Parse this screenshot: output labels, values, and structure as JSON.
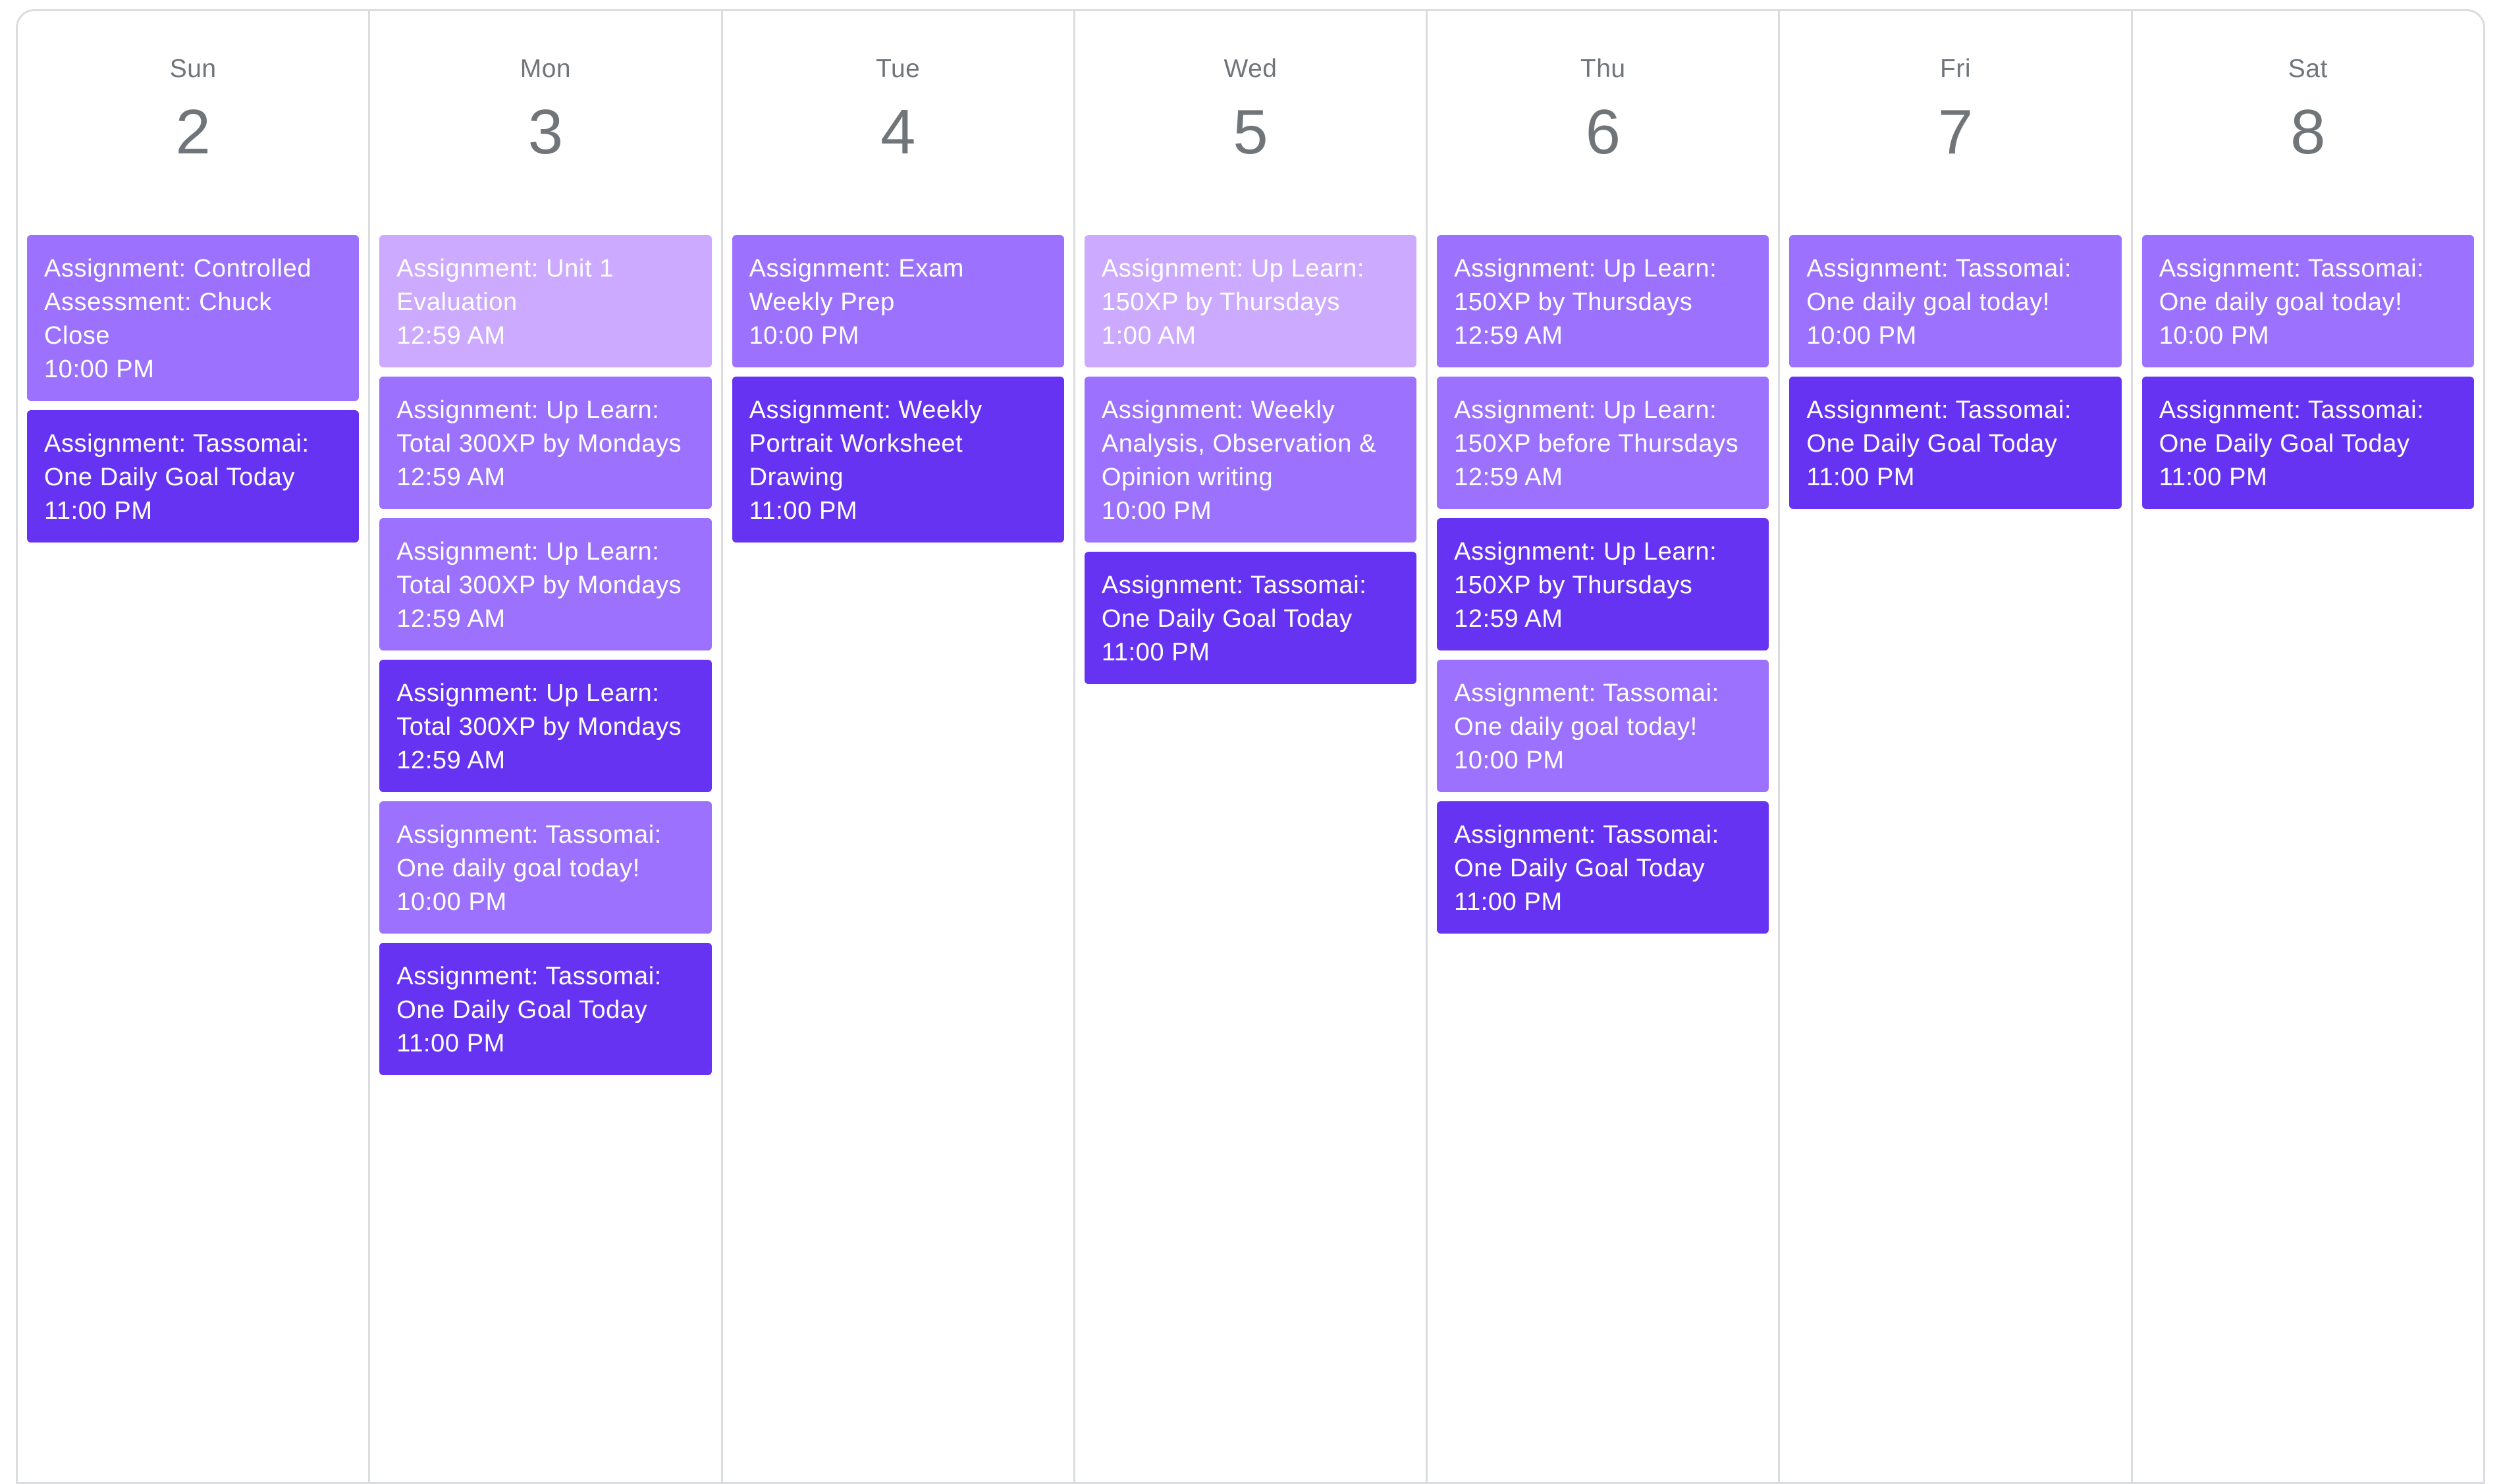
{
  "calendar": {
    "colors": {
      "light": "#ccaaff",
      "mid": "#9b71fe",
      "dark": "#6633f2",
      "header_text": "#70757a",
      "grid_line": "#dadce0"
    },
    "days": [
      {
        "name": "Sun",
        "date": "2",
        "events": [
          {
            "title": "Assignment: Controlled Assessment: Chuck Close",
            "time": "10:00 PM",
            "shade": "mid"
          },
          {
            "title": "Assignment: Tassomai: One Daily Goal Today",
            "time": "11:00 PM",
            "shade": "dark"
          }
        ]
      },
      {
        "name": "Mon",
        "date": "3",
        "events": [
          {
            "title": "Assignment: Unit 1 Evaluation",
            "time": "12:59 AM",
            "shade": "light"
          },
          {
            "title": "Assignment: Up Learn: Total 300XP by Mondays",
            "time": "12:59 AM",
            "shade": "mid"
          },
          {
            "title": "Assignment: Up Learn: Total 300XP by Mondays",
            "time": "12:59 AM",
            "shade": "mid"
          },
          {
            "title": "Assignment: Up Learn: Total 300XP by Mondays",
            "time": "12:59 AM",
            "shade": "dark"
          },
          {
            "title": "Assignment: Tassomai: One daily goal today!",
            "time": "10:00 PM",
            "shade": "mid"
          },
          {
            "title": "Assignment: Tassomai: One Daily Goal Today",
            "time": "11:00 PM",
            "shade": "dark"
          }
        ]
      },
      {
        "name": "Tue",
        "date": "4",
        "events": [
          {
            "title": "Assignment: Exam Weekly Prep",
            "time": "10:00 PM",
            "shade": "mid"
          },
          {
            "title": "Assignment: Weekly Portrait Worksheet Drawing",
            "time": "11:00 PM",
            "shade": "dark"
          }
        ]
      },
      {
        "name": "Wed",
        "date": "5",
        "events": [
          {
            "title": "Assignment: Up Learn: 150XP by Thursdays",
            "time": "1:00 AM",
            "shade": "light"
          },
          {
            "title": "Assignment: Weekly Analysis, Observation & Opinion writing",
            "time": "10:00 PM",
            "shade": "mid"
          },
          {
            "title": "Assignment: Tassomai: One Daily Goal Today",
            "time": "11:00 PM",
            "shade": "dark"
          }
        ]
      },
      {
        "name": "Thu",
        "date": "6",
        "events": [
          {
            "title": "Assignment: Up Learn: 150XP by Thursdays",
            "time": "12:59 AM",
            "shade": "mid"
          },
          {
            "title": "Assignment: Up Learn: 150XP before Thursdays",
            "time": "12:59 AM",
            "shade": "mid"
          },
          {
            "title": "Assignment: Up Learn: 150XP by Thursdays",
            "time": "12:59 AM",
            "shade": "dark"
          },
          {
            "title": "Assignment: Tassomai: One daily goal today!",
            "time": "10:00 PM",
            "shade": "mid"
          },
          {
            "title": "Assignment: Tassomai: One Daily Goal Today",
            "time": "11:00 PM",
            "shade": "dark"
          }
        ]
      },
      {
        "name": "Fri",
        "date": "7",
        "events": [
          {
            "title": "Assignment: Tassomai: One daily goal today!",
            "time": "10:00 PM",
            "shade": "mid"
          },
          {
            "title": "Assignment: Tassomai: One Daily Goal Today",
            "time": "11:00 PM",
            "shade": "dark"
          }
        ]
      },
      {
        "name": "Sat",
        "date": "8",
        "events": [
          {
            "title": "Assignment: Tassomai: One daily goal today!",
            "time": "10:00 PM",
            "shade": "mid"
          },
          {
            "title": "Assignment: Tassomai: One Daily Goal Today",
            "time": "11:00 PM",
            "shade": "dark"
          }
        ]
      }
    ]
  }
}
